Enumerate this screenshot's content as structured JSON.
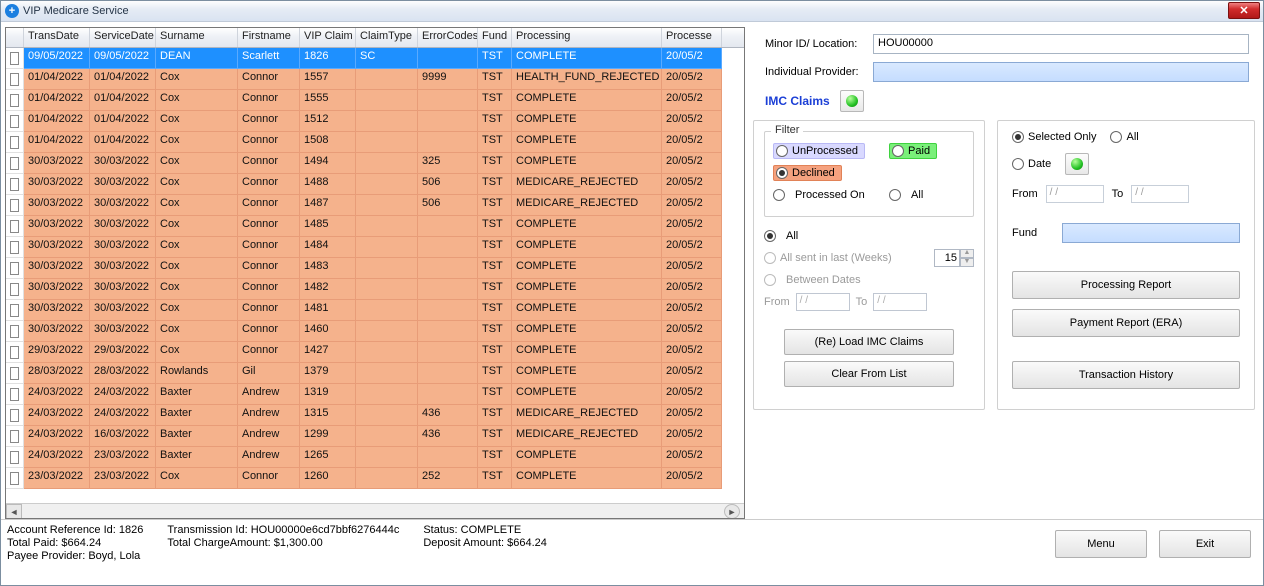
{
  "title": "VIP Medicare Service",
  "columns": [
    "TransDate",
    "ServiceDate",
    "Surname",
    "Firstname",
    "VIP Claim",
    "ClaimType",
    "ErrorCodes",
    "Fund",
    "Processing",
    "Processe"
  ],
  "rows": [
    {
      "sel": true,
      "d": [
        "09/05/2022",
        "09/05/2022",
        "DEAN",
        "Scarlett",
        "1826",
        "SC",
        "",
        "TST",
        "COMPLETE",
        "20/05/2"
      ]
    },
    {
      "d": [
        "01/04/2022",
        "01/04/2022",
        "Cox",
        "Connor",
        "1557",
        "",
        "9999",
        "TST",
        "HEALTH_FUND_REJECTED",
        "20/05/2"
      ]
    },
    {
      "d": [
        "01/04/2022",
        "01/04/2022",
        "Cox",
        "Connor",
        "1555",
        "",
        "",
        "TST",
        "COMPLETE",
        "20/05/2"
      ]
    },
    {
      "d": [
        "01/04/2022",
        "01/04/2022",
        "Cox",
        "Connor",
        "1512",
        "",
        "",
        "TST",
        "COMPLETE",
        "20/05/2"
      ]
    },
    {
      "d": [
        "01/04/2022",
        "01/04/2022",
        "Cox",
        "Connor",
        "1508",
        "",
        "",
        "TST",
        "COMPLETE",
        "20/05/2"
      ]
    },
    {
      "d": [
        "30/03/2022",
        "30/03/2022",
        "Cox",
        "Connor",
        "1494",
        "",
        "325",
        "TST",
        "COMPLETE",
        "20/05/2"
      ]
    },
    {
      "d": [
        "30/03/2022",
        "30/03/2022",
        "Cox",
        "Connor",
        "1488",
        "",
        "506",
        "TST",
        "MEDICARE_REJECTED",
        "20/05/2"
      ]
    },
    {
      "d": [
        "30/03/2022",
        "30/03/2022",
        "Cox",
        "Connor",
        "1487",
        "",
        "506",
        "TST",
        "MEDICARE_REJECTED",
        "20/05/2"
      ]
    },
    {
      "d": [
        "30/03/2022",
        "30/03/2022",
        "Cox",
        "Connor",
        "1485",
        "",
        "",
        "TST",
        "COMPLETE",
        "20/05/2"
      ]
    },
    {
      "d": [
        "30/03/2022",
        "30/03/2022",
        "Cox",
        "Connor",
        "1484",
        "",
        "",
        "TST",
        "COMPLETE",
        "20/05/2"
      ]
    },
    {
      "d": [
        "30/03/2022",
        "30/03/2022",
        "Cox",
        "Connor",
        "1483",
        "",
        "",
        "TST",
        "COMPLETE",
        "20/05/2"
      ]
    },
    {
      "d": [
        "30/03/2022",
        "30/03/2022",
        "Cox",
        "Connor",
        "1482",
        "",
        "",
        "TST",
        "COMPLETE",
        "20/05/2"
      ]
    },
    {
      "d": [
        "30/03/2022",
        "30/03/2022",
        "Cox",
        "Connor",
        "1481",
        "",
        "",
        "TST",
        "COMPLETE",
        "20/05/2"
      ]
    },
    {
      "d": [
        "30/03/2022",
        "30/03/2022",
        "Cox",
        "Connor",
        "1460",
        "",
        "",
        "TST",
        "COMPLETE",
        "20/05/2"
      ]
    },
    {
      "d": [
        "29/03/2022",
        "29/03/2022",
        "Cox",
        "Connor",
        "1427",
        "",
        "",
        "TST",
        "COMPLETE",
        "20/05/2"
      ]
    },
    {
      "d": [
        "28/03/2022",
        "28/03/2022",
        "Rowlands",
        "Gil",
        "1379",
        "",
        "",
        "TST",
        "COMPLETE",
        "20/05/2"
      ]
    },
    {
      "d": [
        "24/03/2022",
        "24/03/2022",
        "Baxter",
        "Andrew",
        "1319",
        "",
        "",
        "TST",
        "COMPLETE",
        "20/05/2"
      ]
    },
    {
      "d": [
        "24/03/2022",
        "24/03/2022",
        "Baxter",
        "Andrew",
        "1315",
        "",
        "436",
        "TST",
        "MEDICARE_REJECTED",
        "20/05/2"
      ]
    },
    {
      "d": [
        "24/03/2022",
        "16/03/2022",
        "Baxter",
        "Andrew",
        "1299",
        "",
        "436",
        "TST",
        "MEDICARE_REJECTED",
        "20/05/2"
      ]
    },
    {
      "d": [
        "24/03/2022",
        "23/03/2022",
        "Baxter",
        "Andrew",
        "1265",
        "",
        "",
        "TST",
        "COMPLETE",
        "20/05/2"
      ]
    },
    {
      "d": [
        "23/03/2022",
        "23/03/2022",
        "Cox",
        "Connor",
        "1260",
        "",
        "252",
        "TST",
        "COMPLETE",
        "20/05/2"
      ]
    }
  ],
  "header": {
    "minor_label": "Minor ID/ Location:",
    "minor_value": "HOU00000",
    "indiv_label": "Individual Provider:"
  },
  "imc_label": "IMC Claims",
  "filter": {
    "legend": "Filter",
    "unprocessed": "UnProcessed",
    "paid": "Paid",
    "declined": "Declined",
    "processed_on": "Processed On",
    "all": "All",
    "all2": "All",
    "all_sent": "All sent in last (Weeks)",
    "weeks_value": "15",
    "between": "Between Dates",
    "from": "From",
    "to": "To",
    "date_placeholder": "/   /"
  },
  "buttons": {
    "reload": "(Re) Load IMC Claims",
    "clear": "Clear From List",
    "proc_report": "Processing Report",
    "pay_report": "Payment Report (ERA)",
    "trans_history": "Transaction History",
    "menu": "Menu",
    "exit": "Exit"
  },
  "right": {
    "selected_only": "Selected Only",
    "all": "All",
    "date": "Date",
    "from": "From",
    "to": "To",
    "fund": "Fund",
    "date_placeholder": "/   /"
  },
  "status": {
    "acct": "Account Reference Id: 1826",
    "paid": "Total Paid: $664.24",
    "payee": "Payee Provider: Boyd, Lola",
    "trans": "Transmission Id: HOU00000e6cd7bbf6276444c",
    "charge": "Total ChargeAmount: $1,300.00",
    "status": "Status: COMPLETE",
    "deposit": "Deposit Amount: $664.24"
  }
}
